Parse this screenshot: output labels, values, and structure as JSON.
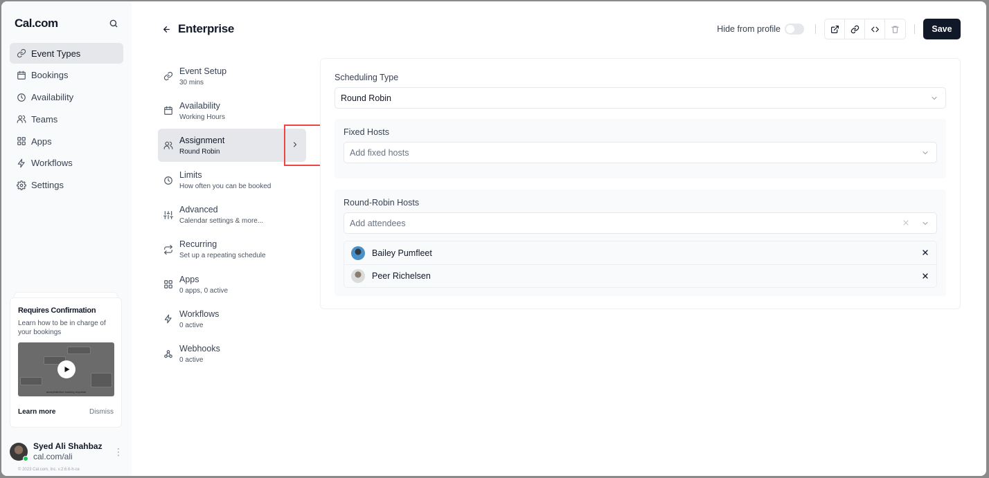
{
  "sidebar": {
    "brand": "Cal.com",
    "nav": [
      {
        "label": "Event Types",
        "icon": "link-icon",
        "active": true
      },
      {
        "label": "Bookings",
        "icon": "calendar-icon"
      },
      {
        "label": "Availability",
        "icon": "clock-icon"
      },
      {
        "label": "Teams",
        "icon": "users-icon"
      },
      {
        "label": "Apps",
        "icon": "grid-icon"
      },
      {
        "label": "Workflows",
        "icon": "zap-icon"
      },
      {
        "label": "Settings",
        "icon": "gear-icon"
      }
    ],
    "promo": {
      "title": "Requires Confirmation",
      "description": "Learn how to be in charge of your bookings",
      "video_caption": "accept/decline booking requests",
      "learn_more": "Learn more",
      "dismiss": "Dismiss"
    },
    "user": {
      "name": "Syed Ali Shahbaz",
      "handle": "cal.com/ali",
      "status": "online"
    },
    "copyright": "© 2023 Cal.com, Inc. v.2.6.6-h-ce"
  },
  "header": {
    "title": "Enterprise",
    "hide_from_profile_label": "Hide from profile",
    "hide_from_profile": false,
    "save_label": "Save"
  },
  "tabs": [
    {
      "title": "Event Setup",
      "subtitle": "30 mins",
      "icon": "link-icon"
    },
    {
      "title": "Availability",
      "subtitle": "Working Hours",
      "icon": "calendar-icon"
    },
    {
      "title": "Assignment",
      "subtitle": "Round Robin",
      "icon": "users-icon",
      "active": true
    },
    {
      "title": "Limits",
      "subtitle": "How often you can be booked",
      "icon": "clock-icon"
    },
    {
      "title": "Advanced",
      "subtitle": "Calendar settings & more...",
      "icon": "sliders-icon"
    },
    {
      "title": "Recurring",
      "subtitle": "Set up a repeating schedule",
      "icon": "repeat-icon"
    },
    {
      "title": "Apps",
      "subtitle": "0 apps, 0 active",
      "icon": "grid-icon"
    },
    {
      "title": "Workflows",
      "subtitle": "0 active",
      "icon": "zap-icon"
    },
    {
      "title": "Webhooks",
      "subtitle": "0 active",
      "icon": "webhook-icon"
    }
  ],
  "assignment": {
    "scheduling_type_label": "Scheduling Type",
    "scheduling_type_value": "Round Robin",
    "fixed_hosts_label": "Fixed Hosts",
    "fixed_hosts_placeholder": "Add fixed hosts",
    "rr_hosts_label": "Round-Robin Hosts",
    "rr_hosts_placeholder": "Add attendees",
    "rr_hosts": [
      {
        "name": "Bailey Pumfleet"
      },
      {
        "name": "Peer Richelsen"
      }
    ]
  },
  "colors": {
    "primary": "#111827",
    "highlight": "#ef4444",
    "online": "#22c55e"
  }
}
